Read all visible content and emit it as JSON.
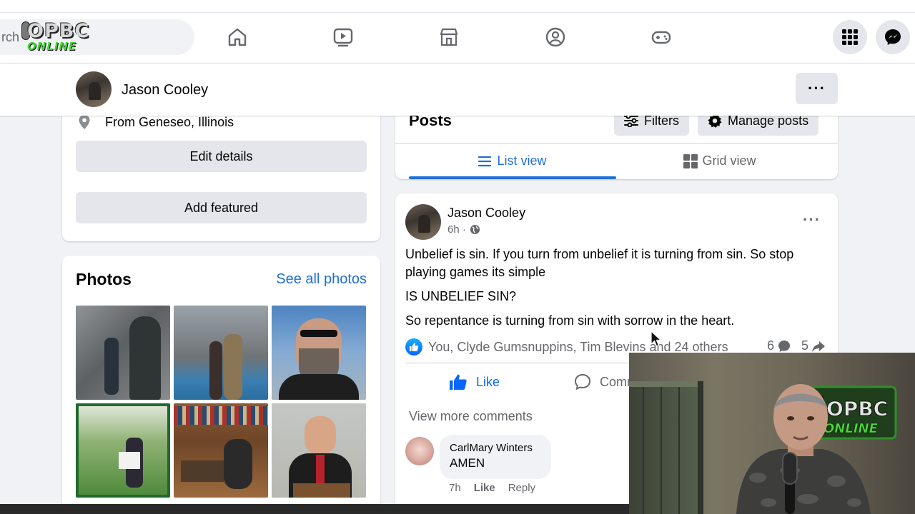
{
  "nav": {
    "search_placeholder": "rch",
    "logo_top": "OPBC",
    "logo_bottom": "ONLINE",
    "icons": [
      "home-icon",
      "watch-icon",
      "marketplace-icon",
      "groups-icon",
      "gaming-icon"
    ],
    "right_icons": [
      "menu-grid-icon",
      "messenger-icon"
    ]
  },
  "profile": {
    "name": "Jason Cooley"
  },
  "intro": {
    "from_label": "From",
    "from_city": "Geneseo, Illinois",
    "edit_details": "Edit details",
    "add_featured": "Add featured"
  },
  "photos": {
    "title": "Photos",
    "see_all": "See all photos"
  },
  "posts": {
    "title": "Posts",
    "filters": "Filters",
    "manage": "Manage posts",
    "list_view": "List view",
    "grid_view": "Grid view"
  },
  "post": {
    "author": "Jason Cooley",
    "time": "6h ·",
    "line1": "Unbelief is sin. If you turn from unbelief it is turning from sin. So stop playing games its simple",
    "line2": "IS UNBELIEF SIN?",
    "line3": "So repentance is turning from sin with sorrow in the heart.",
    "reactions": "You, Clyde Gumsnuppins, Tim Blevins and 24 others",
    "comment_count": "6",
    "share_count": "5",
    "like_label": "Like",
    "comment_label": "Comm",
    "view_more": "View more comments"
  },
  "comment": {
    "name": "CarlMary Winters",
    "text": "AMEN",
    "time": "7h",
    "like": "Like",
    "reply": "Reply"
  },
  "webcam": {
    "sign_top": "OPBC",
    "sign_bottom": "ONLINE"
  },
  "colors": {
    "accent": "#216fdb",
    "like_blue": "#0866ff",
    "background": "#f0f2f5"
  }
}
